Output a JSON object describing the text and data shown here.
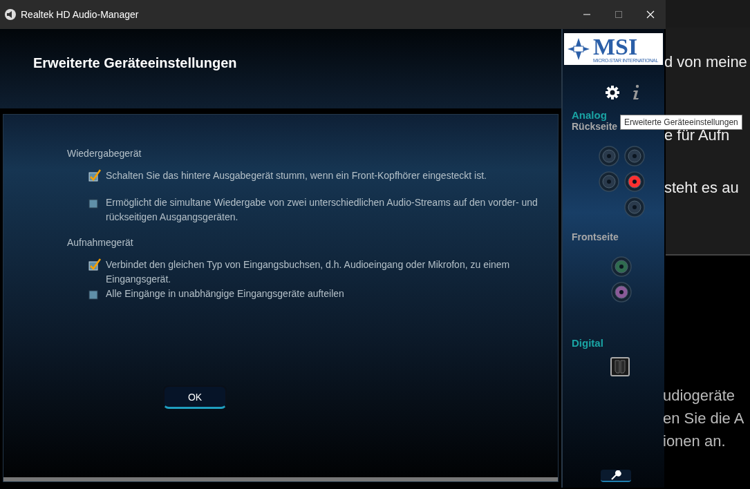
{
  "window": {
    "title": "Realtek HD Audio-Manager"
  },
  "header": {
    "title": "Erweiterte Geräteeinstellungen"
  },
  "sections": [
    {
      "title": "Wiedergabegerät",
      "options": [
        {
          "label": "Schalten Sie das hintere Ausgabegerät stumm, wenn ein Front-Kopfhörer eingesteckt ist.",
          "checked": true
        },
        {
          "label": "Ermöglicht die simultane Wiedergabe von zwei unterschiedlichen Audio-Streams auf den vorder- und rückseitigen Ausgangsgeräten.",
          "checked": false
        }
      ]
    },
    {
      "title": "Aufnahmegerät",
      "options": [
        {
          "label": "Verbindet den gleichen Typ von Eingangsbuchsen, d.h. Audioeingang oder Mikrofon, zu einem Eingangsgerät.",
          "checked": true
        },
        {
          "label": "Alle Eingänge in unabhängige Eingangsgeräte aufteilen",
          "checked": false
        }
      ]
    }
  ],
  "ok_button": "OK",
  "sidebar": {
    "logo": "MSI",
    "logo_subtitle": "MICRO-STAR INTERNATIONAL",
    "analog_title": "Analog",
    "rear_title": "Rückseite",
    "rear_jacks": [
      {
        "color": "#2a3a4c"
      },
      {
        "color": "#2a3a4c"
      },
      {
        "color": "#2a3a4c"
      },
      {
        "color": "#ff3030"
      },
      {
        "color": "#2a3a4c"
      }
    ],
    "front_title": "Frontseite",
    "front_jacks": [
      {
        "color": "#2f6b4f"
      },
      {
        "color": "#8a5a98"
      }
    ],
    "digital_title": "Digital"
  },
  "tooltip": "Erweiterte Geräteeinstellungen",
  "background_window": {
    "texts_top": [
      "d von meine",
      "e für Aufn",
      "steht es au"
    ],
    "texts_bottom": [
      "udiogeräte",
      "en Sie die A",
      "ionen an."
    ]
  }
}
